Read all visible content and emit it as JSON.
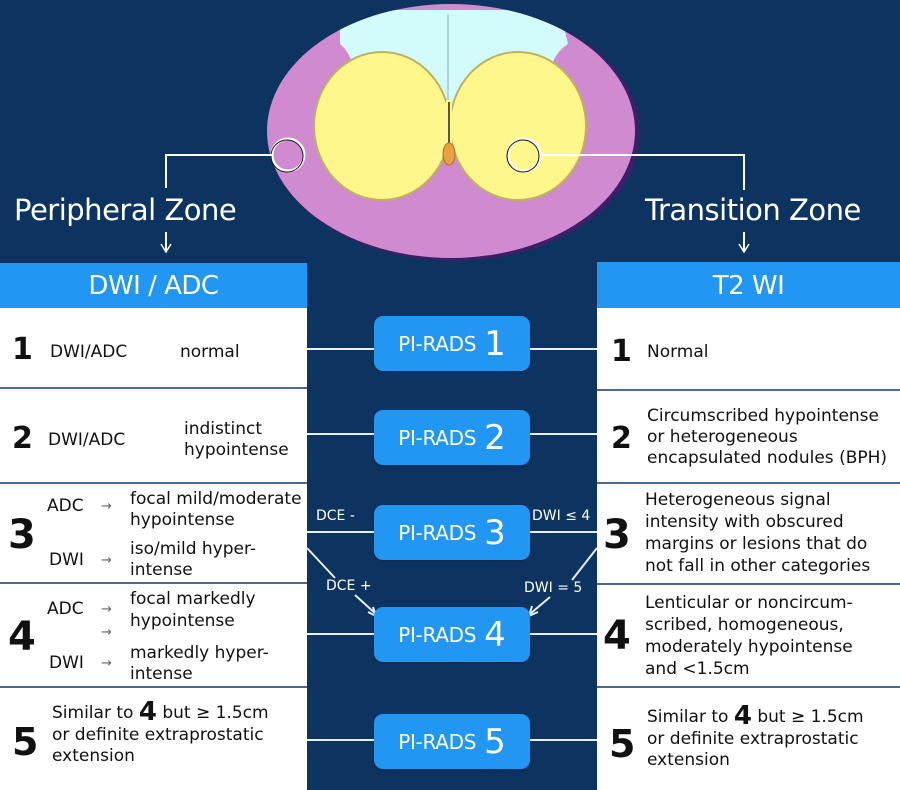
{
  "diagram": {
    "zones": {
      "peripheral": "Peripheral Zone",
      "transition": "Transition Zone"
    },
    "colors": {
      "background": "#0d3460",
      "header_blue": "#2196f3",
      "peripheral_zone": "#d08bd0",
      "transition_zone": "#fff68c",
      "anterior_stroma": "#d4fbfb",
      "urethra": "#e8a040"
    },
    "left_column": {
      "header": "DWI / ADC",
      "rows": [
        {
          "score": "1",
          "label": "DWI/ADC",
          "desc": "normal"
        },
        {
          "score": "2",
          "label": "DWI/ADC",
          "desc_line1": "indistinct",
          "desc_line2": "hypointense"
        },
        {
          "score": "3",
          "adc_label": "ADC",
          "adc_desc_line1": "focal mild/moderate",
          "adc_desc_line2": "hypointense",
          "dwi_label": "DWI",
          "dwi_desc_line1": "iso/mild hyper-",
          "dwi_desc_line2": "intense"
        },
        {
          "score": "4",
          "adc_label": "ADC",
          "adc_desc_line1": "focal markedly",
          "adc_desc_line2": "hypointense",
          "dwi_label": "DWI",
          "dwi_desc_line1": "markedly hyper-",
          "dwi_desc_line2": "intense"
        },
        {
          "score": "5",
          "line1_pre": "Similar to",
          "line1_num": "4",
          "line1_post": "but ≥ 1.5cm",
          "line2": "or definite extraprostatic",
          "line3": "extension"
        }
      ]
    },
    "right_column": {
      "header": "T2 WI",
      "rows": [
        {
          "score": "1",
          "desc": "Normal"
        },
        {
          "score": "2",
          "lines": [
            "Circumscribed hypointense",
            "or heterogeneous",
            "encapsulated nodules (BPH)"
          ]
        },
        {
          "score": "3",
          "lines": [
            "Heterogeneous signal",
            "intensity with obscured",
            "margins or lesions that do",
            "not fall in other categories"
          ]
        },
        {
          "score": "4",
          "lines": [
            "Lenticular or noncircum-",
            "scribed, homogeneous,",
            "moderately hypointense",
            "and <1.5cm"
          ]
        },
        {
          "score": "5",
          "line1_pre": "Similar to",
          "line1_num": "4",
          "line1_post": "but ≥ 1.5cm",
          "line2": "or definite extraprostatic",
          "line3": "extension"
        }
      ]
    },
    "pirads": [
      {
        "label": "PI-RADS",
        "score": "1"
      },
      {
        "label": "PI-RADS",
        "score": "2"
      },
      {
        "label": "PI-RADS",
        "score": "3"
      },
      {
        "label": "PI-RADS",
        "score": "4"
      },
      {
        "label": "PI-RADS",
        "score": "5"
      }
    ],
    "edge_labels": {
      "dce_minus": "DCE -",
      "dce_plus": "DCE +",
      "dwi_le4": "DWI ≤ 4",
      "dwi_eq5": "DWI = 5"
    }
  }
}
